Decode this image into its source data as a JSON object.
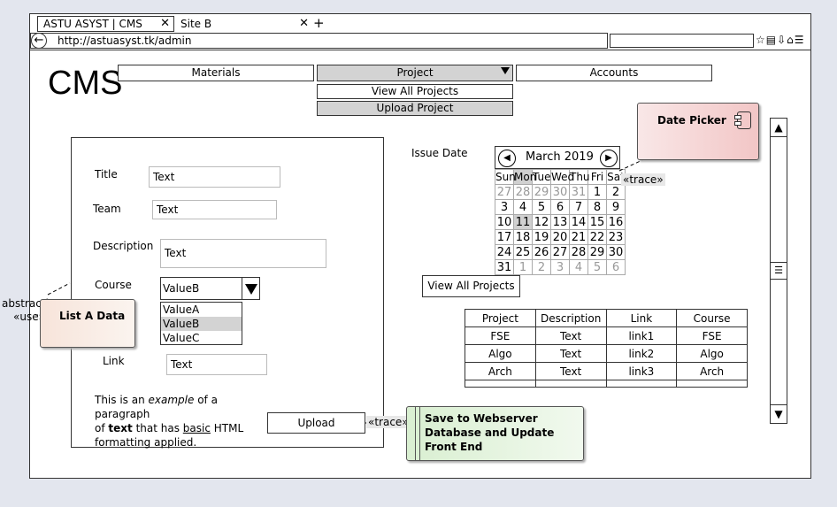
{
  "browser": {
    "tabs": [
      {
        "label": "ASTU ASYST | CMS"
      },
      {
        "label": "Site B"
      }
    ],
    "new_tab_label": "+",
    "close_label": "✕",
    "url": "http://astuasyst.tk/admin",
    "back_glyph": "←",
    "toolbar_icons": "☆▤⇩⌂☰"
  },
  "app": {
    "logo": "CMS",
    "nav": {
      "materials": "Materials",
      "project": "Project",
      "accounts": "Accounts",
      "project_menu": [
        "View All Projects",
        "Upload Project"
      ]
    }
  },
  "form": {
    "title_label": "Title",
    "title_value": "Text",
    "team_label": "Team",
    "team_value": "Text",
    "description_label": "Description",
    "description_value": "Text",
    "course_label": "Course",
    "course_value": "ValueB",
    "course_options": [
      "ValueA",
      "ValueB",
      "ValueC"
    ],
    "link_label": "Link",
    "link_value": "Text",
    "paragraph": {
      "p1": "This is an ",
      "p2": "example",
      "p3": " of a paragraph",
      "p4": "of ",
      "p5": "text",
      "p6": " that has ",
      "p7": "basic",
      "p8": " HTML",
      "p9": "formatting applied."
    },
    "upload_button": "Upload"
  },
  "issue_date": {
    "label": "Issue Date",
    "month": "March 2019",
    "prev_glyph": "◀",
    "next_glyph": "▶",
    "weekdays": [
      "Sun",
      "Mon",
      "Tue",
      "Wed",
      "Thu",
      "Fri",
      "Sat"
    ],
    "weeks": [
      [
        "27",
        "28",
        "29",
        "30",
        "31",
        "1",
        "2"
      ],
      [
        "3",
        "4",
        "5",
        "6",
        "7",
        "8",
        "9"
      ],
      [
        "10",
        "11",
        "12",
        "13",
        "14",
        "15",
        "16"
      ],
      [
        "17",
        "18",
        "19",
        "20",
        "21",
        "22",
        "23"
      ],
      [
        "24",
        "25",
        "26",
        "27",
        "28",
        "29",
        "30"
      ],
      [
        "31",
        "1",
        "2",
        "3",
        "4",
        "5",
        "6"
      ]
    ]
  },
  "view_all_button": "View All Projects",
  "projects_table": {
    "columns": [
      "Project",
      "Description",
      "Link",
      "Course"
    ],
    "rows": [
      [
        "FSE",
        "Text",
        "link1",
        "FSE"
      ],
      [
        "Algo",
        "Text",
        "link2",
        "Algo"
      ],
      [
        "Arch",
        "Text",
        "link3",
        "Arch"
      ],
      [
        "",
        "",
        "",
        ""
      ]
    ]
  },
  "annotations": {
    "date_picker": "Date Picker",
    "trace1": "«trace»",
    "trace2": "«trace»",
    "abstraction": "abstraction»",
    "use": "«use»",
    "list_a_data": "List A Data",
    "save_note": "Save to Webserver Database and Update Front End"
  },
  "scrollbar": {
    "up": "▲",
    "down": "▼",
    "thumb": "☰"
  }
}
